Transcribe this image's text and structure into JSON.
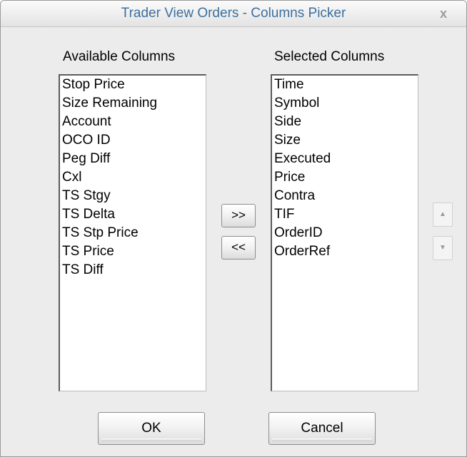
{
  "window": {
    "title": "Trader View Orders - Columns Picker",
    "close_glyph": "x"
  },
  "available": {
    "label": "Available Columns",
    "items": [
      "Stop Price",
      "Size Remaining",
      "Account",
      "OCO ID",
      "Peg Diff",
      "Cxl",
      "TS Stgy",
      "TS Delta",
      "TS Stp Price",
      "TS Price",
      "TS Diff"
    ]
  },
  "selected": {
    "label": "Selected Columns",
    "items": [
      "Time",
      "Symbol",
      "Side",
      "Size",
      "Executed",
      "Price",
      "Contra",
      "TIF",
      "OrderID",
      "OrderRef"
    ]
  },
  "buttons": {
    "add": ">>",
    "remove": "<<",
    "ok": "OK",
    "cancel": "Cancel",
    "move_up_glyph": "▲",
    "move_down_glyph": "▼"
  },
  "icons": {
    "close": "close-icon",
    "up": "arrow-up-icon",
    "down": "arrow-down-icon"
  }
}
